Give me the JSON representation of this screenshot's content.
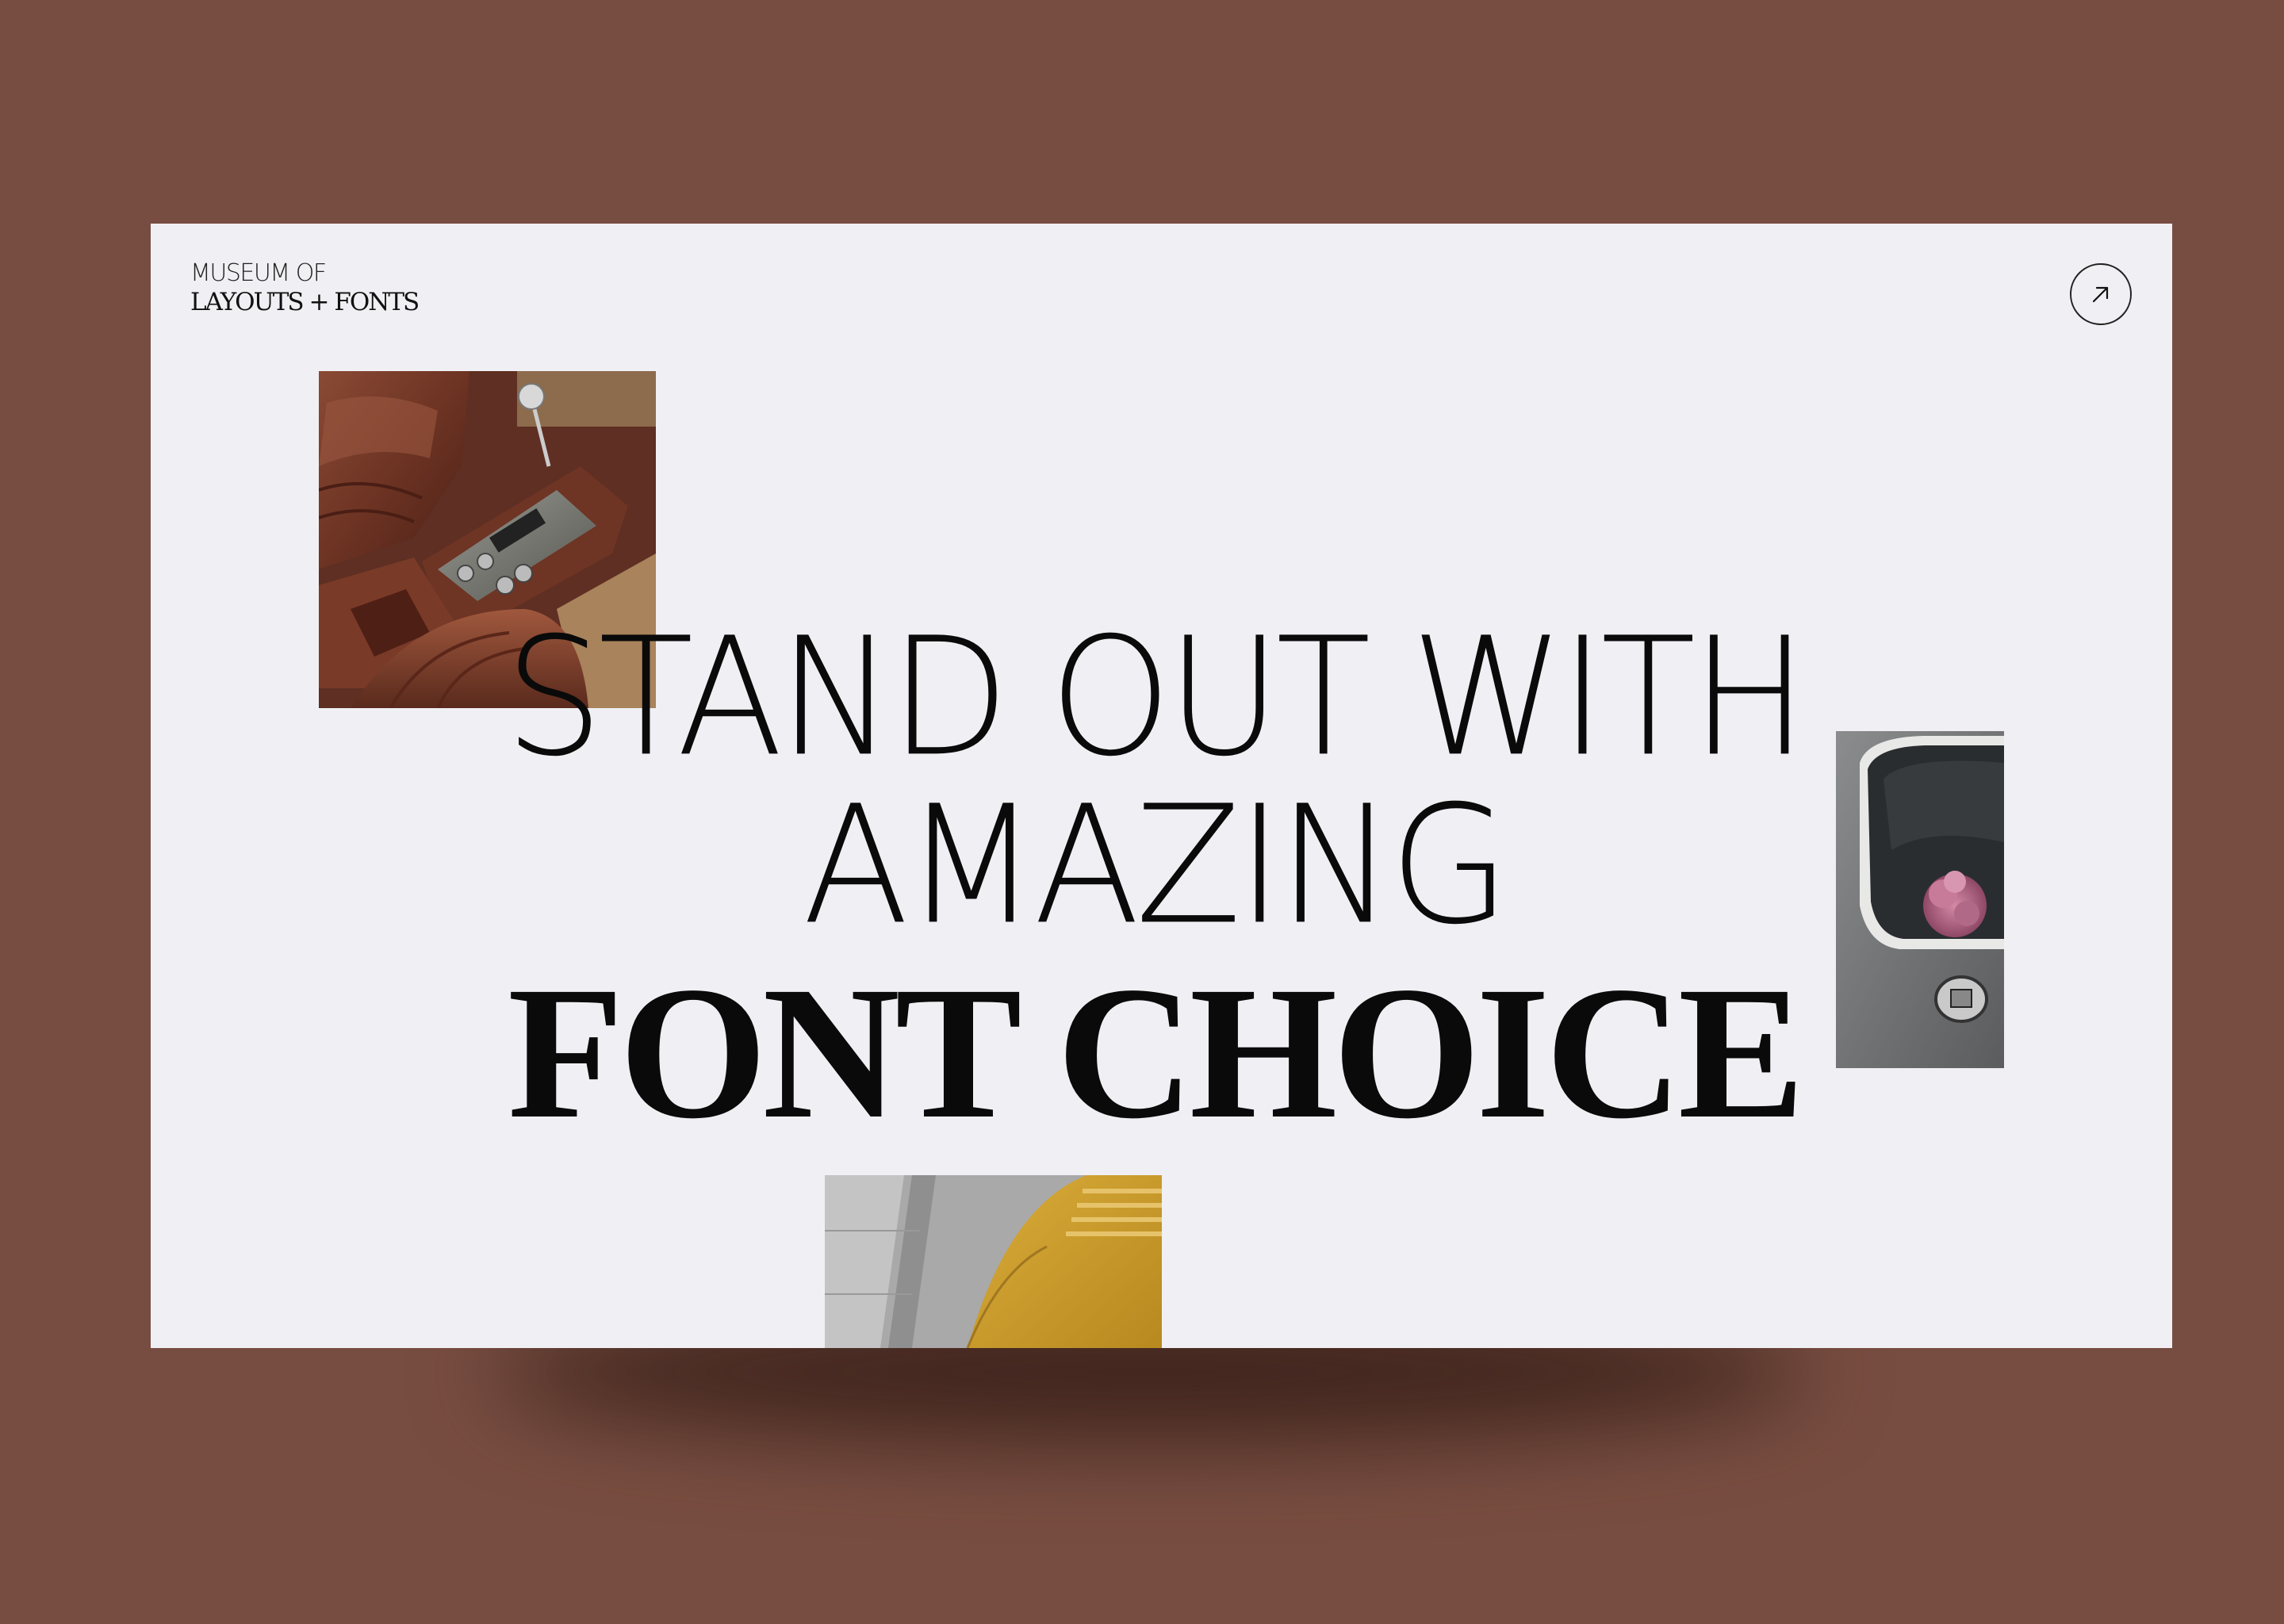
{
  "brand": {
    "line1": "MUSEUM OF",
    "line2": "LAYOUTS + FONTS"
  },
  "corner_button": {
    "icon": "arrow-up-right-icon"
  },
  "headline": {
    "line1": "STAND OUT WITH",
    "line2": "AMAZING",
    "line3": "FONT CHOICE"
  },
  "photos": [
    {
      "name": "car-interior-photo"
    },
    {
      "name": "car-window-flower-photo"
    },
    {
      "name": "yellow-car-hood-photo"
    }
  ],
  "colors": {
    "background": "#784d41",
    "page": "#f0f0f4",
    "text": "#0a0a0a"
  }
}
